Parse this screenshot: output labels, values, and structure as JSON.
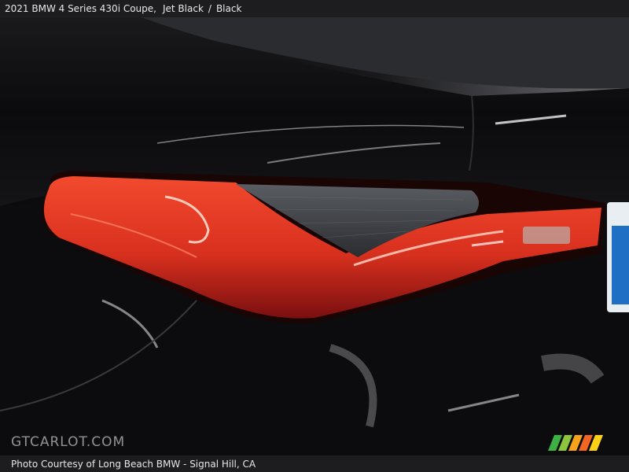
{
  "header": {
    "vehicle": "2021 BMW 4 Series 430i Coupe,",
    "exterior": "Jet Black",
    "separator": "/",
    "interior": "Black"
  },
  "watermark": {
    "text": "GTCARLOT.COM"
  },
  "footer": {
    "credit": "Photo Courtesy of Long Beach BMW - Signal Hill, CA"
  },
  "photo": {
    "subject": "tail-light",
    "colors": {
      "paint": "#0b0b0d",
      "lamp_red": "#e0331f",
      "lamp_dark": "#7a0f10",
      "lens_gray": "#4a4d52",
      "plate_blue": "#1f6fc4"
    }
  },
  "brand_stripes": {
    "colors": [
      "#3cb043",
      "#8cc63f",
      "#f7a21b",
      "#f26522",
      "#fcd116"
    ]
  }
}
